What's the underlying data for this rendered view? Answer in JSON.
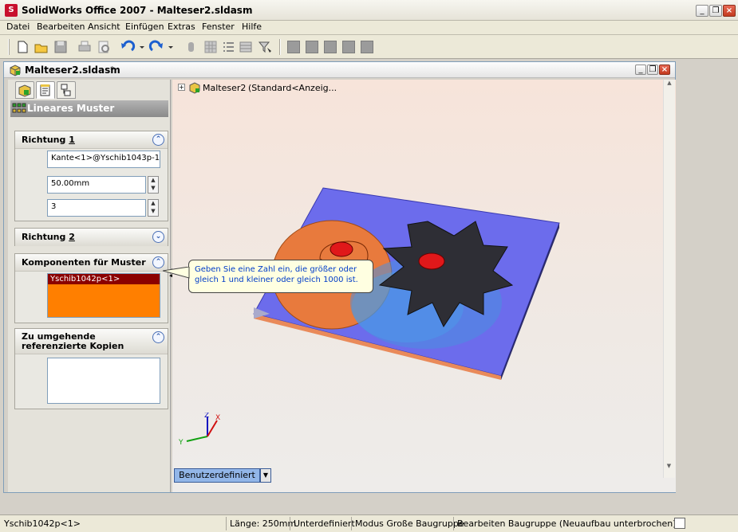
{
  "window": {
    "title": "SolidWorks Office 2007 - Malteser2.sldasm",
    "icon": "solidworks-logo-icon"
  },
  "menu": [
    "Datei",
    "Bearbeiten",
    "Ansicht",
    "Einfügen",
    "Extras",
    "Fenster",
    "Hilfe"
  ],
  "toolbar": {
    "buttons": [
      "new-icon",
      "open-icon",
      "save-icon",
      "print-icon",
      "print-preview-icon",
      "undo-icon",
      "redo-icon",
      "select-icon",
      "grid-icon",
      "list-icon",
      "table-icon",
      "filter-icon",
      "view1-icon",
      "view2-icon",
      "view3-icon",
      "view4-icon",
      "view5-icon"
    ]
  },
  "document": {
    "title": "Malteser2.sldasm",
    "modified_marker": "*"
  },
  "property_manager": {
    "title": "Lineares Muster",
    "direction1": {
      "label": "Richtung",
      "num": "1",
      "edge": "Kante<1>@Yschib1043p-1",
      "distance": "50.00mm",
      "count": "3"
    },
    "direction2": {
      "label": "Richtung",
      "num": "2"
    },
    "components": {
      "label": "Komponenten für Muster",
      "items": [
        "Yschib1042p<1>"
      ]
    },
    "skip": {
      "label": "Zu umgehende referenzierte Kopien"
    }
  },
  "tooltip": "Geben Sie eine Zahl ein, die größer oder gleich 1 und kleiner oder gleich 1000 ist.",
  "tree": {
    "root": "Malteser2",
    "config": "(Standard<Anzeig..."
  },
  "view_tab": {
    "label": "Benutzerdefiniert"
  },
  "status": {
    "selection": "Yschib1042p<1>",
    "length": "Länge: 250mm",
    "defined": "Unterdefiniert",
    "mode": "Modus Große Baugruppe",
    "edit": "Bearbeiten Baugruppe (Neuaufbau unterbrochen)"
  },
  "colors": {
    "accent": "#6f6fe6",
    "part_orange": "#f07a30",
    "highlight": "#e0181a"
  }
}
